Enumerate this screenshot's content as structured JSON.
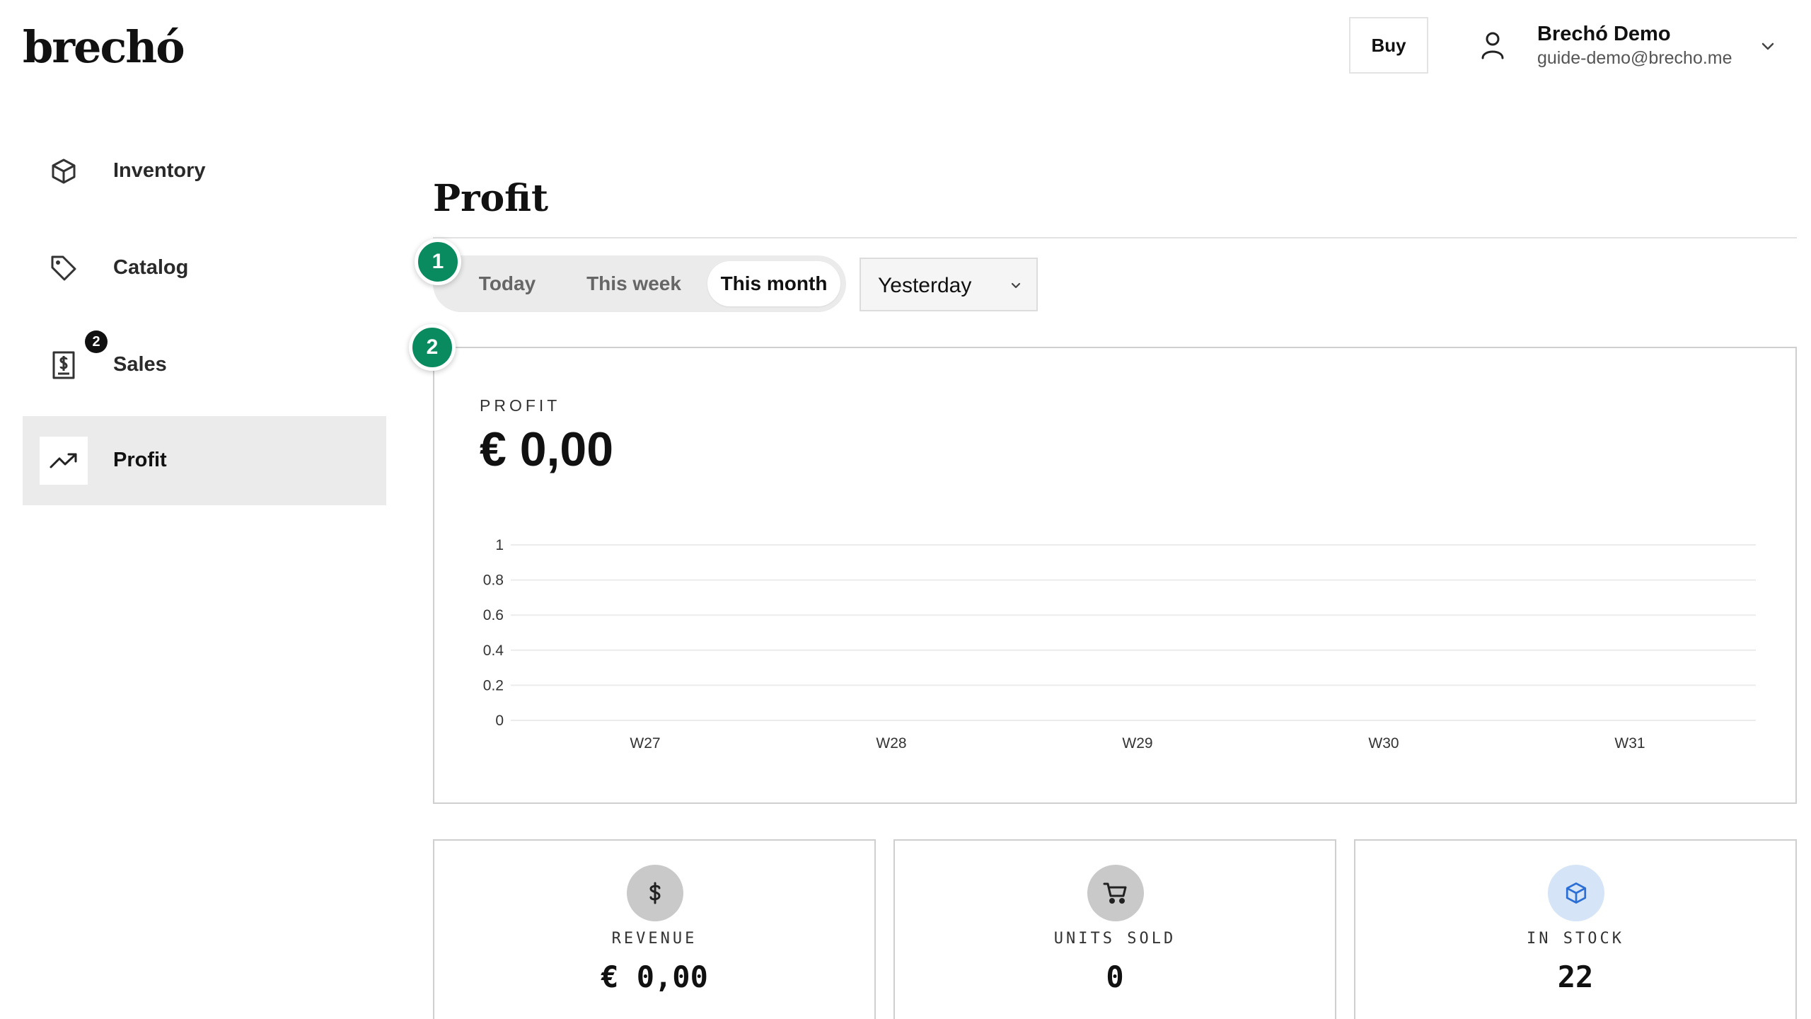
{
  "app": {
    "logo": "brechó"
  },
  "header": {
    "buy_label": "Buy",
    "user_name": "Brechó Demo",
    "user_email": "guide-demo@brecho.me"
  },
  "sidebar": {
    "items": [
      {
        "label": "Inventory",
        "icon": "cube-icon"
      },
      {
        "label": "Catalog",
        "icon": "tag-icon"
      },
      {
        "label": "Sales",
        "icon": "receipt-dollar-icon",
        "badge": "2"
      },
      {
        "label": "Profit",
        "icon": "trending-up-icon",
        "active": true
      }
    ]
  },
  "main": {
    "title": "Profit",
    "ranges": [
      "Today",
      "This week",
      "This month"
    ],
    "active_range": "This month",
    "compare_select": "Yesterday",
    "steps": [
      "1",
      "2"
    ]
  },
  "profit_card": {
    "kicker": "PROFIT",
    "value": "€ 0,00"
  },
  "chart_data": {
    "type": "line",
    "categories": [
      "W27",
      "W28",
      "W29",
      "W30",
      "W31"
    ],
    "series": [
      {
        "values": [
          0,
          0,
          0,
          0,
          0
        ]
      }
    ],
    "yticks": [
      "1",
      "0.8",
      "0.6",
      "0.4",
      "0.2",
      "0"
    ],
    "ylim": [
      0,
      1
    ],
    "grid": true,
    "title": "",
    "xlabel": "",
    "ylabel": ""
  },
  "stats": [
    {
      "label": "REVENUE",
      "value": "€ 0,00",
      "icon": "dollar-icon",
      "color": "#c9c9c9"
    },
    {
      "label": "UNITS SOLD",
      "value": "0",
      "icon": "cart-icon",
      "color": "#c9c9c9"
    },
    {
      "label": "IN STOCK",
      "value": "22",
      "icon": "box-icon",
      "color": "#d6e4f7"
    }
  ],
  "colors": {
    "accent_step": "#0a8a5f",
    "active_nav_bg": "#ebebeb",
    "stock_icon": "#2b6fd6"
  }
}
